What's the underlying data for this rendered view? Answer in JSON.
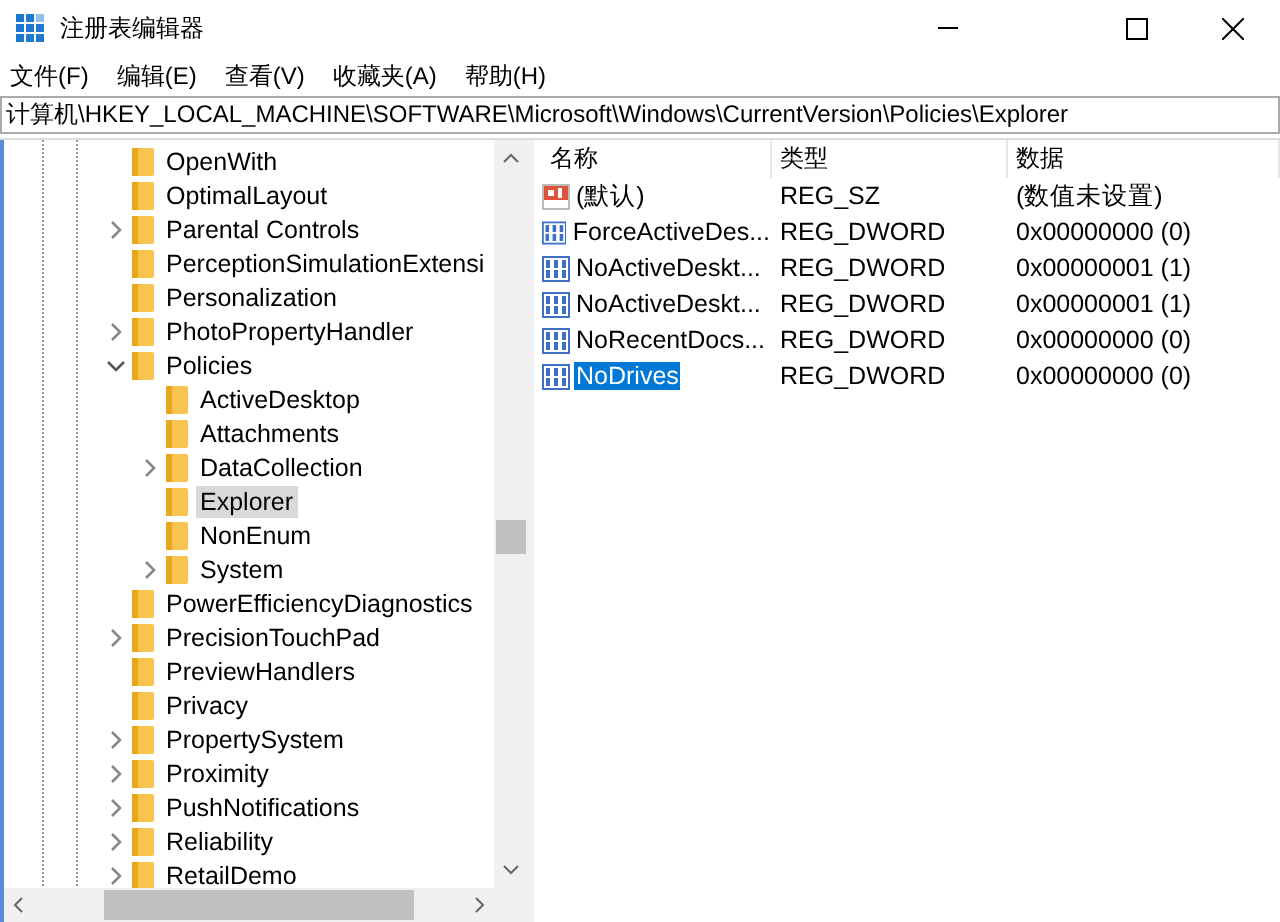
{
  "window": {
    "title": "注册表编辑器"
  },
  "menu": [
    "文件(F)",
    "编辑(E)",
    "查看(V)",
    "收藏夹(A)",
    "帮助(H)"
  ],
  "address": "计算机\\HKEY_LOCAL_MACHINE\\SOFTWARE\\Microsoft\\Windows\\CurrentVersion\\Policies\\Explorer",
  "tree": [
    {
      "label": "OpenWith",
      "kind": "leaf",
      "selected": false
    },
    {
      "label": "OptimalLayout",
      "kind": "leaf",
      "selected": false
    },
    {
      "label": "Parental Controls",
      "kind": "collapsed",
      "selected": false
    },
    {
      "label": "PerceptionSimulationExtensi",
      "kind": "leaf",
      "selected": false
    },
    {
      "label": "Personalization",
      "kind": "leaf",
      "selected": false
    },
    {
      "label": "PhotoPropertyHandler",
      "kind": "collapsed",
      "selected": false
    },
    {
      "label": "Policies",
      "kind": "expanded",
      "selected": false,
      "children": [
        {
          "label": "ActiveDesktop",
          "kind": "leaf",
          "selected": false
        },
        {
          "label": "Attachments",
          "kind": "leaf",
          "selected": false
        },
        {
          "label": "DataCollection",
          "kind": "collapsed",
          "selected": false
        },
        {
          "label": "Explorer",
          "kind": "leaf",
          "selected": true
        },
        {
          "label": "NonEnum",
          "kind": "leaf",
          "selected": false
        },
        {
          "label": "System",
          "kind": "collapsed",
          "selected": false
        }
      ]
    },
    {
      "label": "PowerEfficiencyDiagnostics",
      "kind": "leaf",
      "selected": false
    },
    {
      "label": "PrecisionTouchPad",
      "kind": "collapsed",
      "selected": false
    },
    {
      "label": "PreviewHandlers",
      "kind": "leaf",
      "selected": false
    },
    {
      "label": "Privacy",
      "kind": "leaf",
      "selected": false
    },
    {
      "label": "PropertySystem",
      "kind": "collapsed",
      "selected": false
    },
    {
      "label": "Proximity",
      "kind": "collapsed",
      "selected": false
    },
    {
      "label": "PushNotifications",
      "kind": "collapsed",
      "selected": false
    },
    {
      "label": "Reliability",
      "kind": "collapsed",
      "selected": false
    },
    {
      "label": "RetailDemo",
      "kind": "collapsed",
      "selected": false
    }
  ],
  "values": {
    "columns": [
      "名称",
      "类型",
      "数据"
    ],
    "rows": [
      {
        "kind": "string",
        "name": "(默认)",
        "type": "REG_SZ",
        "data": "(数值未设置)",
        "selected": false
      },
      {
        "kind": "dword",
        "name": "ForceActiveDes...",
        "type": "REG_DWORD",
        "data": "0x00000000 (0)",
        "selected": false
      },
      {
        "kind": "dword",
        "name": "NoActiveDeskt...",
        "type": "REG_DWORD",
        "data": "0x00000001 (1)",
        "selected": false
      },
      {
        "kind": "dword",
        "name": "NoActiveDeskt...",
        "type": "REG_DWORD",
        "data": "0x00000001 (1)",
        "selected": false
      },
      {
        "kind": "dword",
        "name": "NoRecentDocs...",
        "type": "REG_DWORD",
        "data": "0x00000000 (0)",
        "selected": false
      },
      {
        "kind": "dword",
        "name": "NoDrives",
        "type": "REG_DWORD",
        "data": "0x00000000 (0)",
        "selected": true
      }
    ]
  }
}
